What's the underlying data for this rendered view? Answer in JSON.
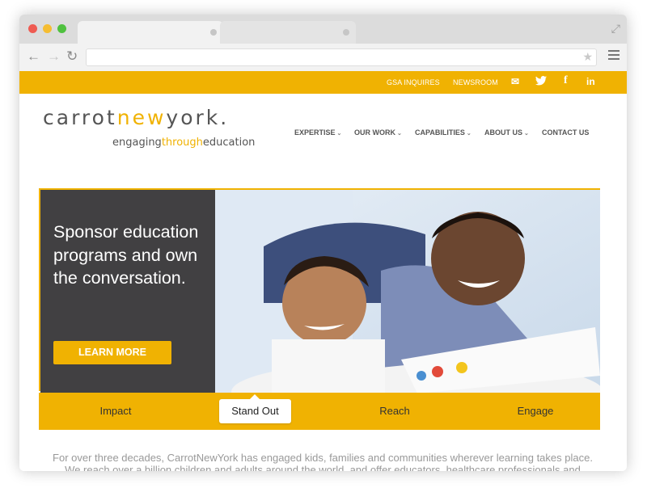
{
  "browser": {
    "address_value": "",
    "icons": [
      "back-arrow-icon",
      "forward-arrow-icon",
      "reload-icon",
      "star-icon",
      "menu-icon",
      "resize-icon"
    ]
  },
  "site": {
    "topbar": {
      "links": [
        "GSA INQUIRES",
        "NEWSROOM"
      ],
      "social_icons": [
        "email-icon",
        "twitter-icon",
        "facebook-icon",
        "linkedin-icon"
      ]
    },
    "logo": {
      "part1": "carrot",
      "part2": "new",
      "part3": "york.",
      "tag1": "engaging",
      "tag2": "through",
      "tag3": "education"
    },
    "nav": [
      {
        "label": "EXPERTISE",
        "chev": "⌄"
      },
      {
        "label": "OUR WORK",
        "chev": "⌄"
      },
      {
        "label": "CAPABILITIES",
        "chev": "⌄"
      },
      {
        "label": "ABOUT US",
        "chev": "⌄"
      },
      {
        "label": "CONTACT US",
        "chev": ""
      }
    ],
    "hero": {
      "heading": "Sponsor education programs and own the conversation.",
      "button": "LEARN MORE"
    },
    "tabs": [
      "Impact",
      "Stand Out",
      "Reach",
      "Engage"
    ],
    "active_tab": "Stand Out",
    "intro": "For over three decades, CarrotNewYork has engaged kids, families and communities wherever learning takes place. We reach over a billion children and adults around the world, and offer educators, healthcare professionals and community leaders interactive and engaging learning"
  },
  "colors": {
    "brand_yellow": "#f0b202",
    "hero_dark": "#414042",
    "text_grey": "#555555"
  }
}
